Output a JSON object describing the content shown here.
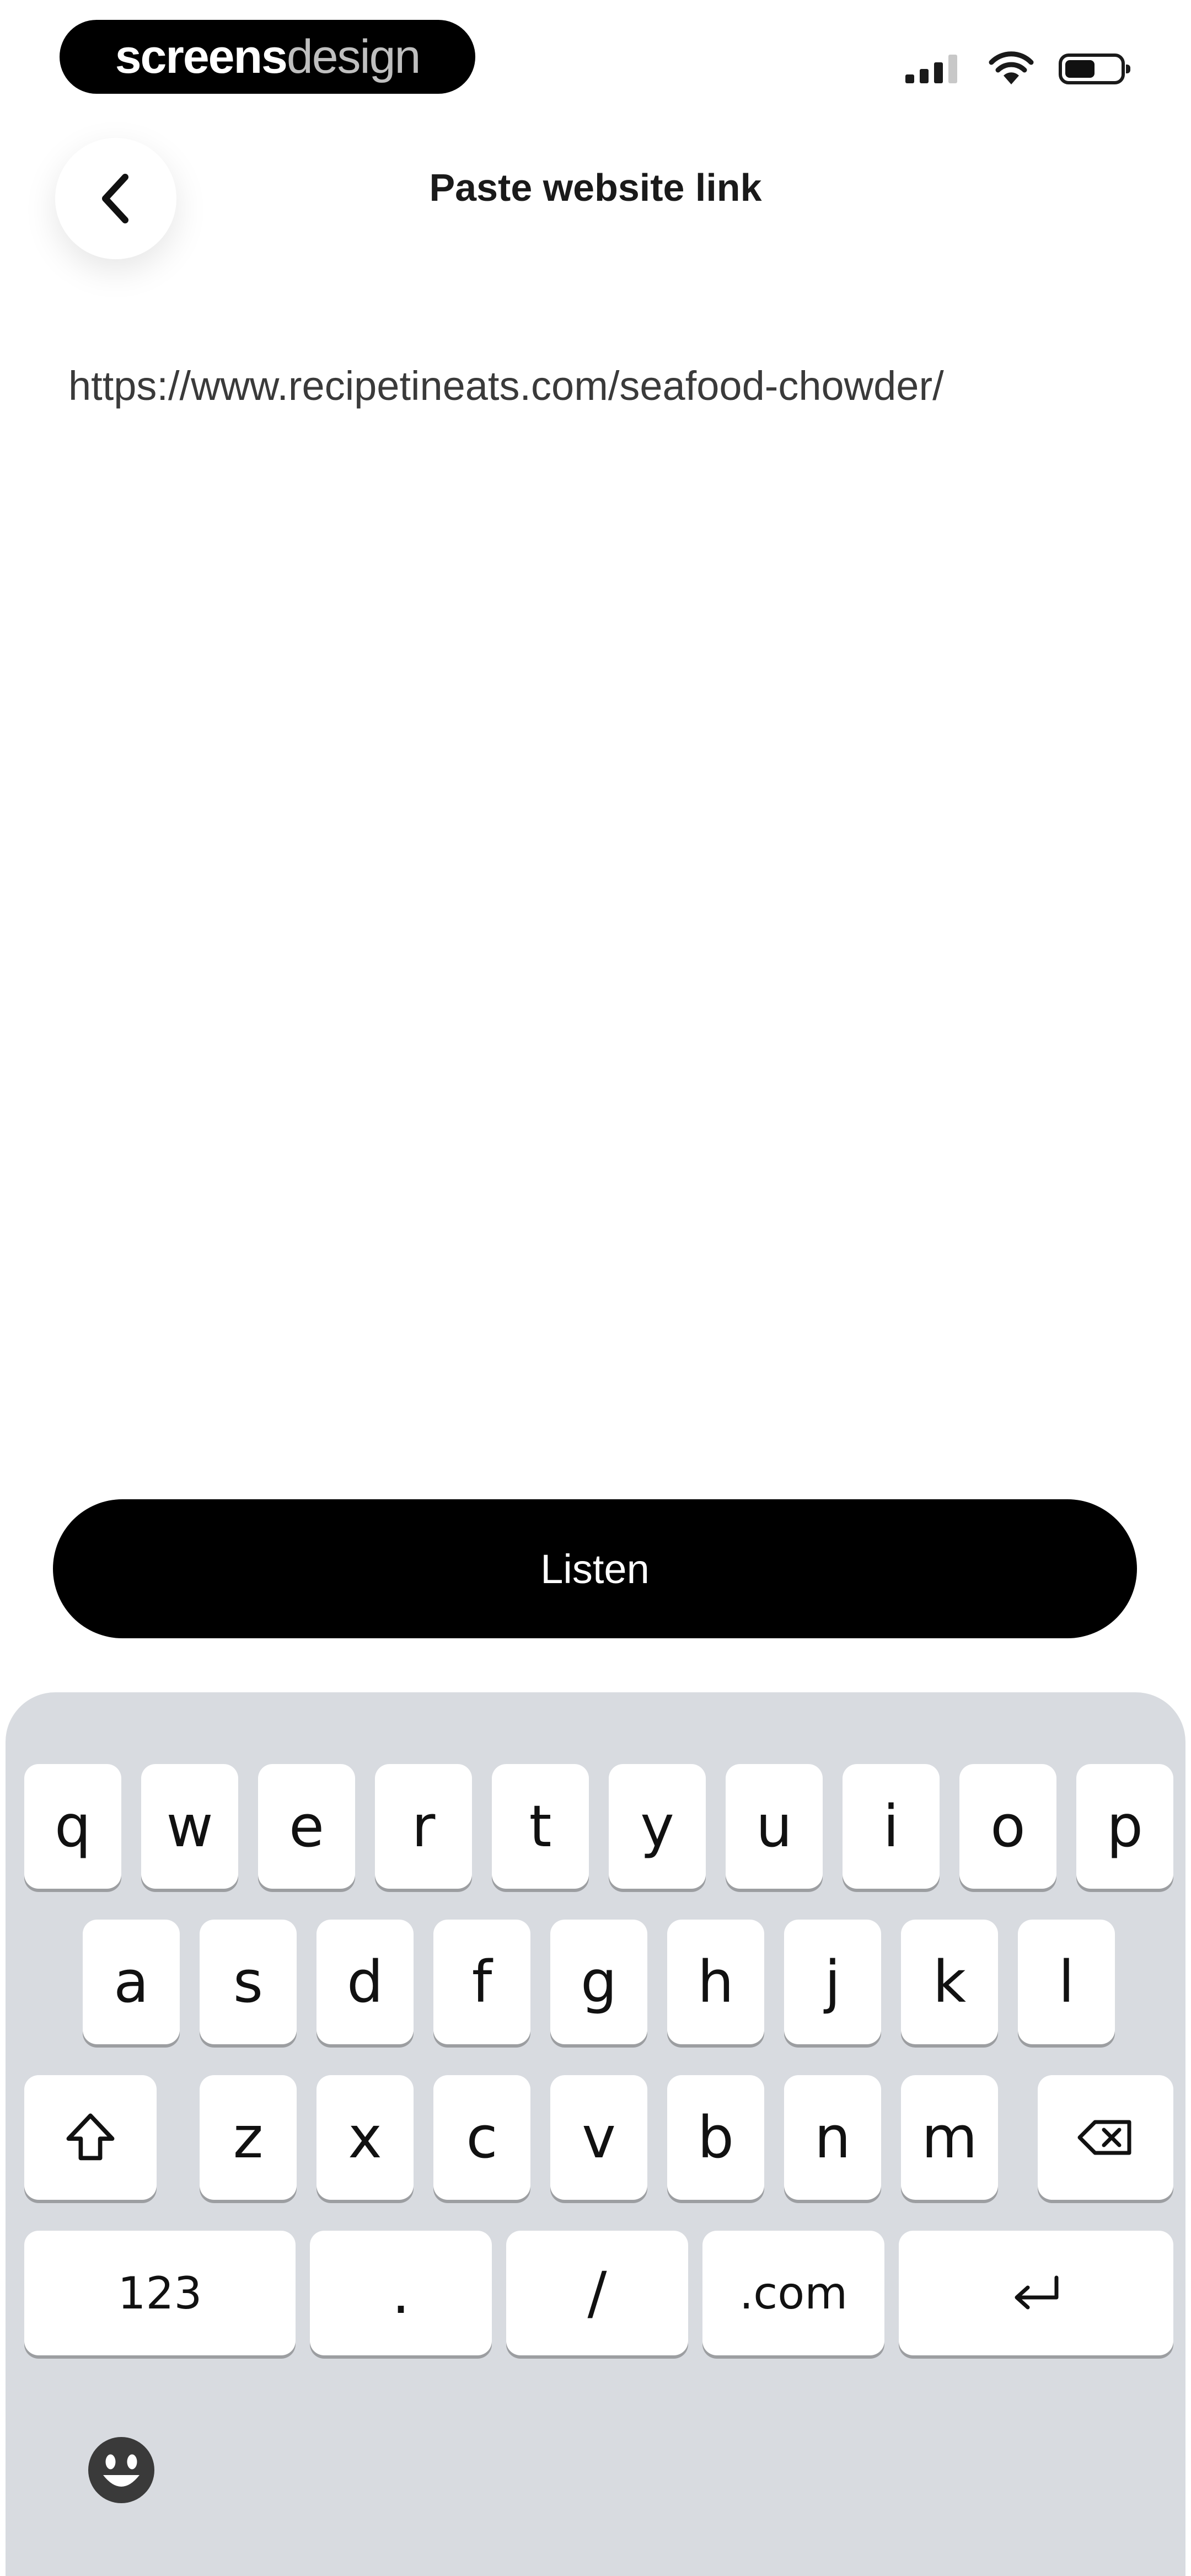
{
  "watermark": {
    "part_bold": "screens",
    "part_light": "design"
  },
  "status_bar": {
    "battery_level": 0.55,
    "icons": [
      "signal-icon",
      "wifi-icon",
      "battery-icon"
    ]
  },
  "header": {
    "back_icon": "chevron-left-icon",
    "title": "Paste website link"
  },
  "link_input": {
    "value": "https://www.recipetineats.com/seafood-chowder/"
  },
  "primary_button": {
    "label": "Listen"
  },
  "keyboard": {
    "row1": [
      "q",
      "w",
      "e",
      "r",
      "t",
      "y",
      "u",
      "i",
      "o",
      "p"
    ],
    "row2": [
      "a",
      "s",
      "d",
      "f",
      "g",
      "h",
      "j",
      "k",
      "l"
    ],
    "row3": [
      "z",
      "x",
      "c",
      "v",
      "b",
      "n",
      "m"
    ],
    "row4": [
      "123",
      ".",
      "/",
      ".com"
    ],
    "icons": {
      "shift": "shift-icon",
      "backspace": "backspace-icon",
      "return": "return-icon",
      "emoji": "emoji-icon"
    }
  }
}
